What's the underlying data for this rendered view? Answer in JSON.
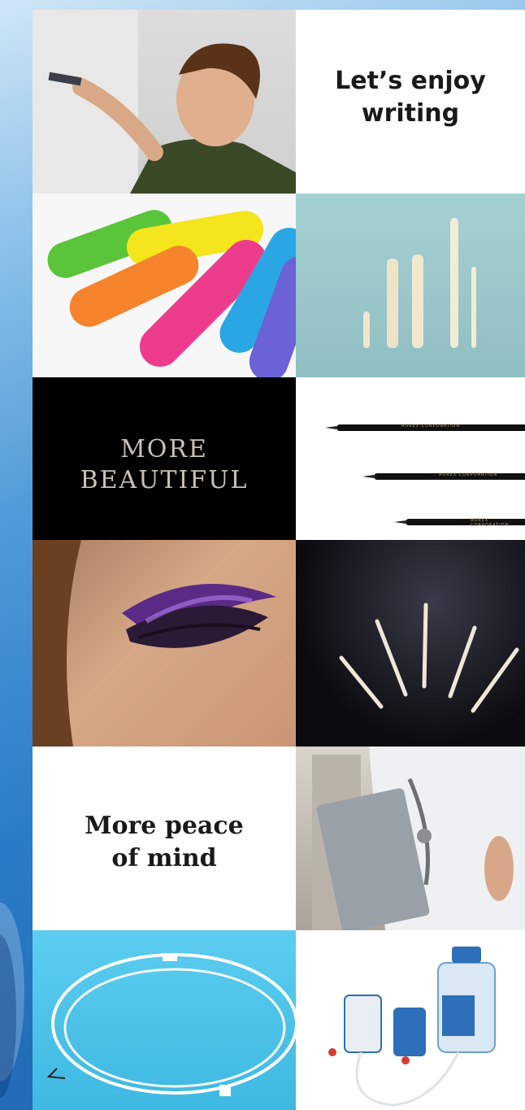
{
  "captions": {
    "writing": [
      "Let’s enjoy",
      "writing"
    ],
    "beautiful": [
      "MORE",
      "BEAUTIFUL"
    ],
    "peace": [
      "More peace",
      "of mind"
    ]
  },
  "pen_brand_text": "AUREX CORPORATION",
  "images": [
    "boy-writing-on-whiteboard",
    "colorful-felt-marker-tips",
    "white-fiber-nibs",
    "black-fine-liner-pens",
    "purple-eye-makeup",
    "white-nibs-on-black",
    "doctor-with-clipboard",
    "medical-catheter-tube",
    "infusion-pump-kit"
  ],
  "colors": {
    "background_blue": "#2b7cc8",
    "teal_tile": "#9cc8cc",
    "cyan_tile": "#4fc3e6"
  }
}
